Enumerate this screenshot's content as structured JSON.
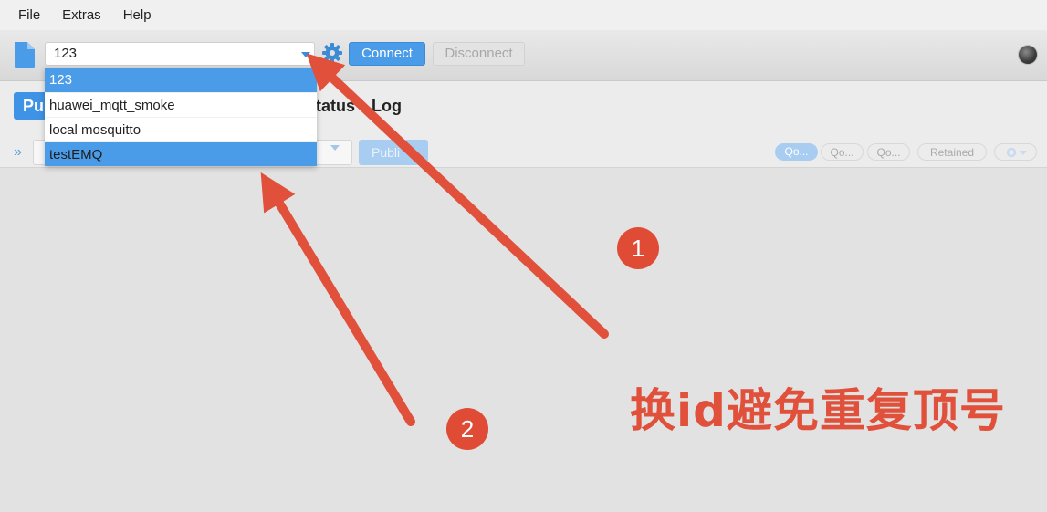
{
  "menu": {
    "items": [
      "File",
      "Extras",
      "Help"
    ]
  },
  "toolbar": {
    "profile_value": "123",
    "connect_label": "Connect",
    "disconnect_label": "Disconnect"
  },
  "dropdown": {
    "options": [
      "123",
      "huawei_mqtt_smoke",
      "local mosquitto",
      "testEMQ"
    ]
  },
  "tabs": {
    "publish": "Pu",
    "status": "tatus",
    "log": "Log"
  },
  "publish": {
    "publish_label": "Publi",
    "qos0": "Qo...",
    "qos1": "Qo...",
    "qos2": "Qo...",
    "retained": "Retained"
  },
  "annotations": {
    "badge1": "1",
    "badge2": "2",
    "note": "换id避免重复顶号"
  },
  "colors": {
    "accent": "#4a9ce8",
    "annotation": "#e0503a"
  }
}
